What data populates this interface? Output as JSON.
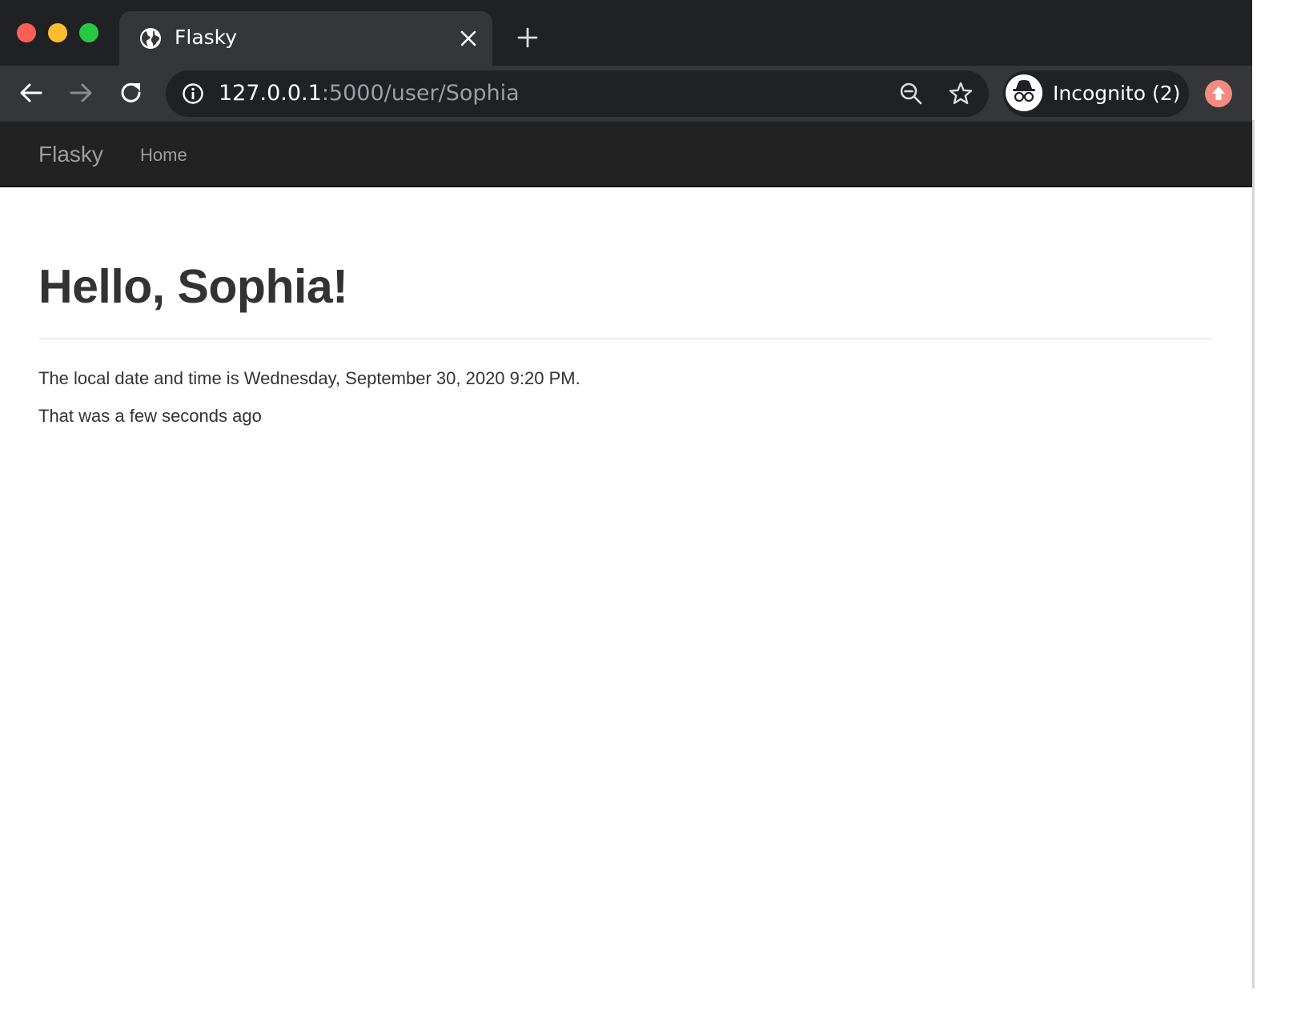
{
  "browser": {
    "tab": {
      "title": "Flasky",
      "favicon": "globe-icon"
    },
    "url": {
      "host": "127.0.0.1",
      "rest": ":5000/user/Sophia"
    },
    "profile": {
      "label": "Incognito (2)",
      "icon": "incognito-icon"
    }
  },
  "navbar": {
    "brand": "Flasky",
    "links": [
      {
        "label": "Home"
      }
    ]
  },
  "page": {
    "heading": "Hello, Sophia!",
    "local_time_text": "The local date and time is Wednesday, September 30, 2020 9:20 PM.",
    "relative_time_text": "That was a few seconds ago"
  }
}
